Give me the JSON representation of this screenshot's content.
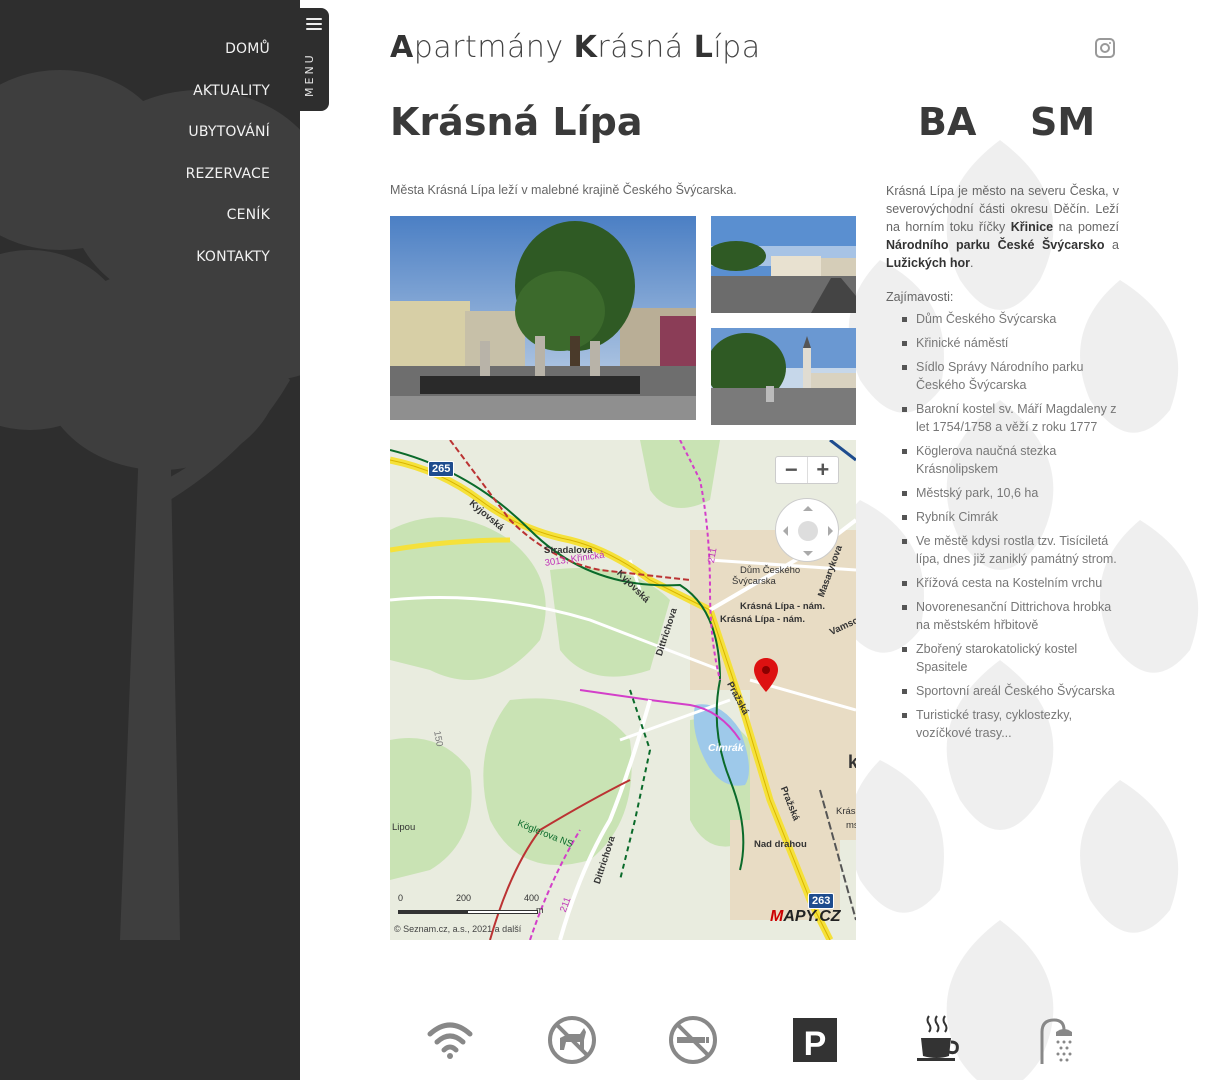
{
  "sidebar": {
    "menu_label": "MENU",
    "items": [
      {
        "label": "DOMŮ"
      },
      {
        "label": "AKTUALITY"
      },
      {
        "label": "UBYTOVÁNÍ"
      },
      {
        "label": "REZERVACE"
      },
      {
        "label": "CENÍK"
      },
      {
        "label": "KONTAKTY"
      }
    ]
  },
  "header": {
    "title_parts": [
      {
        "initial": "A",
        "rest": "partmány "
      },
      {
        "initial": "K",
        "rest": "rásná "
      },
      {
        "initial": "L",
        "rest": "ípa"
      }
    ],
    "instagram_icon": "instagram-icon"
  },
  "main": {
    "title": "Krásná Lípa",
    "intro": "Města Krásná Lípa leží v malebné krajině Českého Švýcarska.",
    "languages": [
      "BA",
      "SM"
    ]
  },
  "map": {
    "zoom_out": "−",
    "zoom_in": "+",
    "labels": {
      "kyjovska1": "Kyjovská",
      "kyjovska2": "Kyjovská",
      "stradalova": "Stradalova",
      "krinicka": "3013, Křinická",
      "dum": "Dům Českého",
      "dum2": "Švýcarska",
      "nam1": "Krásná Lípa - nám.",
      "nam2": "Krásná Lípa - nám.",
      "masarykova": "Masarykova",
      "vams": "Vamso",
      "dittrichova1": "Dittrichova",
      "dittrichova2": "Dittrichova",
      "prazska1": "Pražská",
      "prazska2": "Pražská",
      "cimrak": "Cimrák",
      "nad_drahou": "Nad drahou",
      "koglerova": "Köglerova NS",
      "lipou": "Lipou",
      "kras": "Krás",
      "ms": "ms",
      "k": "k",
      "n150": "150",
      "n211a": "211",
      "n211b": "211",
      "n3013": "3013"
    },
    "road_shields": [
      "265",
      "263"
    ],
    "scale": {
      "s0": "0",
      "s200": "200",
      "s400": "400",
      "unit": "m"
    },
    "copyright": "© Seznam.cz, a.s., 2021 a další",
    "logo_pre": "M",
    "logo_rest": "APY.CZ"
  },
  "description": {
    "p1": "Krásná Lípa je město na severu Česka, v severovýchodní části okresu Děčín. Leží na horním toku říčky ",
    "b1": "Křinice",
    "p2": " na pomezí ",
    "b2": "Národního parku České Švýcarsko",
    "p3": " a ",
    "b3": "Lužických hor",
    "p4": "."
  },
  "attractions": {
    "heading": "Zajímavosti:",
    "items": [
      "Dům Českého Švýcarska",
      "Křinické náměstí",
      "Sídlo Správy Národního parku Českého Švýcarska",
      "Barokní kostel sv. Máří Magdaleny z let 1754/1758 a věží z roku 1777",
      "Köglerova naučná stezka Krásnolipskem",
      "Městský park, 10,6 ha",
      "Rybník Cimrák",
      "Ve městě kdysi rostla tzv. Tisíciletá lípa, dnes již zaniklý památný strom.",
      "Křížová cesta na Kostelním vrchu",
      "Novorenesanční Dittrichova hrobka na městském hřbitově",
      "Zbořený starokatolický kostel Spasitele",
      "Sportovní areál Českého Švýcarska",
      "Turistické trasy, cyklostezky, vozíčkové trasy..."
    ]
  },
  "amenities": [
    {
      "icon": "wifi-icon"
    },
    {
      "icon": "no-pets-icon"
    },
    {
      "icon": "no-smoking-icon"
    },
    {
      "icon": "parking-icon",
      "letter": "P"
    },
    {
      "icon": "coffee-icon"
    },
    {
      "icon": "shower-icon"
    }
  ],
  "colors": {
    "sidebar_bg": "#2e2e2e",
    "text": "#666666",
    "heading": "#3a3a3a",
    "map_road_yellow": "#f5e13a",
    "map_cycle_magenta": "#d33fc9"
  }
}
